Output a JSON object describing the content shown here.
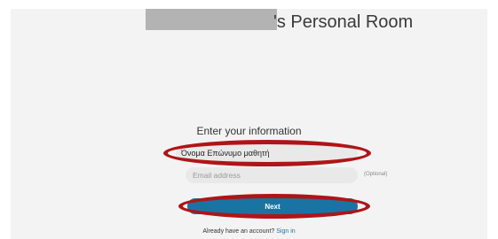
{
  "header": {
    "title_suffix": "'s Personal Room"
  },
  "form": {
    "heading": "Enter your information",
    "name_value": "Όνομα Επώνυμο μαθητή",
    "email_placeholder": "Email address",
    "email_value": "",
    "optional_label": "(Optional)",
    "next_label": "Next"
  },
  "footer": {
    "account_prompt": "Already have an account?",
    "signin_label": "Sign in"
  },
  "colors": {
    "accent": "#1a74a3",
    "annotation": "#b01418",
    "background": "#f3f3f3"
  }
}
